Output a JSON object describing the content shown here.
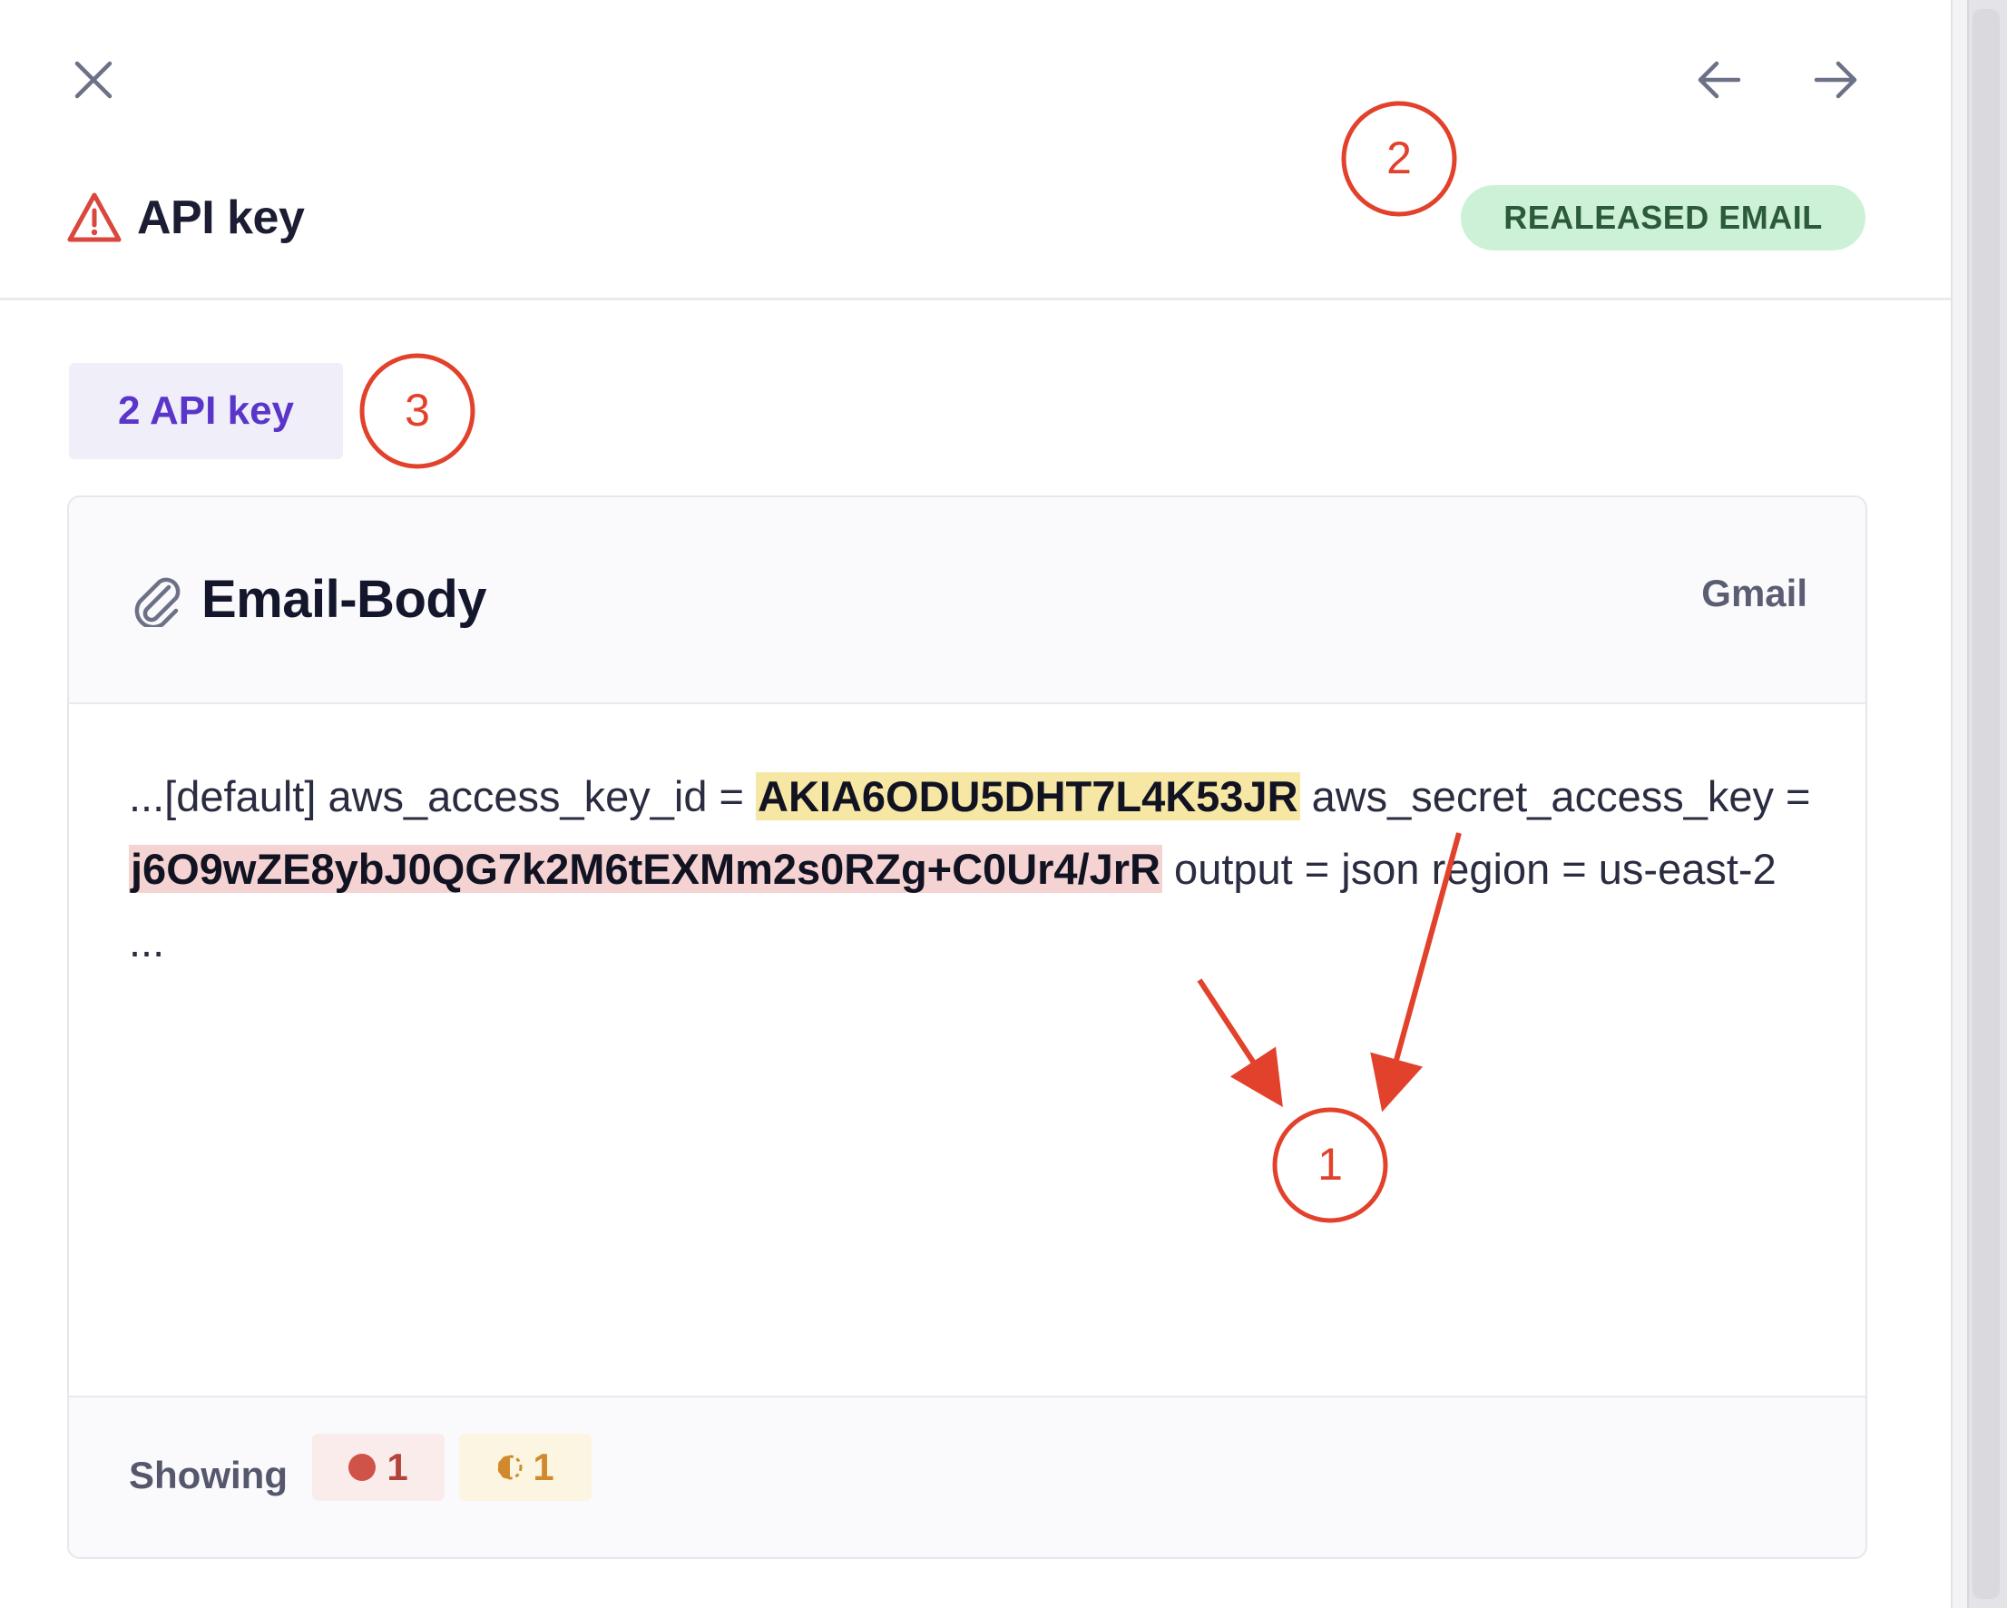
{
  "header": {
    "title": "API key",
    "status_badge": "REALEASED EMAIL"
  },
  "icons": {
    "close": "close-icon",
    "prev": "arrow-left-icon",
    "next": "arrow-right-icon",
    "warning": "warning-triangle-icon",
    "attachment": "paperclip-icon"
  },
  "tab": {
    "label": "2 API key"
  },
  "card": {
    "title": "Email-Body",
    "source": "Gmail",
    "body": {
      "prefix": " ...[default] aws_access_key_id = ",
      "access_key_id": "AKIA6ODU5DHT7L4K53JR",
      "middle": " aws_secret_access_key = ",
      "secret_access_key": "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",
      "suffix": " output = json region = us-east-2",
      "ellipsis": "..."
    },
    "footer": {
      "showing_label": "Showing",
      "critical_count": "1",
      "warning_count": "1"
    }
  },
  "annotations": {
    "marker_1": "1",
    "marker_2": "2",
    "marker_3": "3",
    "color": "#e2412b"
  },
  "colors": {
    "accent_purple": "#5a35c9",
    "badge_green_bg": "#cdf1d6",
    "highlight_yellow": "#f6e7a4",
    "highlight_red": "#f6d3d3"
  }
}
